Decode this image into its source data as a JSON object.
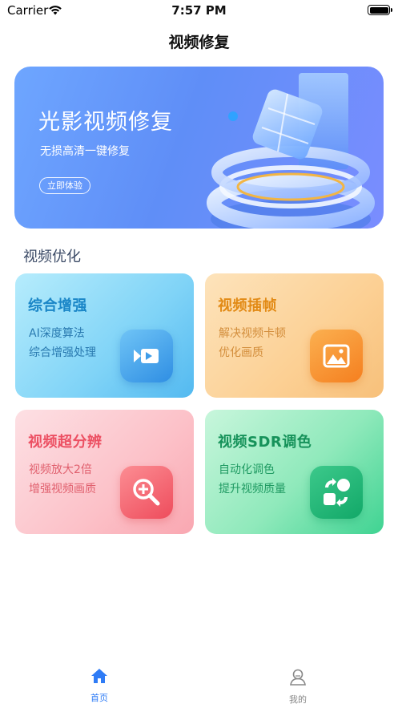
{
  "status_bar": {
    "carrier": "Carrier",
    "time": "7:57 PM"
  },
  "nav": {
    "title": "视频修复"
  },
  "banner": {
    "title": "光影视频修复",
    "subtitle": "无损高清一键修复",
    "button": "立即体验"
  },
  "section": {
    "title": "视频优化"
  },
  "cards": [
    {
      "title": "综合增强",
      "line1": "AI深度算法",
      "line2": "综合增强处理",
      "icon": "video-camera-icon",
      "color": "#1a86c7"
    },
    {
      "title": "视频插帧",
      "line1": "解决视频卡顿",
      "line2": "优化画质",
      "icon": "picture-icon",
      "color": "#e28a15"
    },
    {
      "title": "视频超分辨",
      "line1": "视频放大2倍",
      "line2": "增强视频画质",
      "icon": "zoom-in-icon",
      "color": "#ec4f62"
    },
    {
      "title": "视频SDR调色",
      "line1": "自动化调色",
      "line2": "提升视频质量",
      "icon": "shapes-convert-icon",
      "color": "#16925a"
    }
  ],
  "tabbar": {
    "items": [
      {
        "label": "首页",
        "icon": "home-icon",
        "active": true
      },
      {
        "label": "我的",
        "icon": "user-icon",
        "active": false
      }
    ],
    "active_color": "#2f7cf6"
  }
}
